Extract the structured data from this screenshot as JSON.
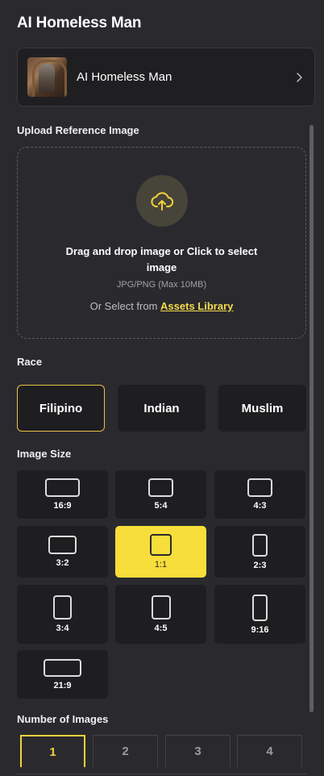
{
  "page": {
    "title": "AI Homeless Man"
  },
  "model": {
    "name": "AI Homeless Man",
    "thumbnail_icon": "model-thumbnail-image",
    "chevron_icon": "chevron-right-icon"
  },
  "upload": {
    "label": "Upload Reference Image",
    "icon": "cloud-upload-icon",
    "main_text": "Drag and drop image or Click to select image",
    "format_text": "JPG/PNG (Max 10MB)",
    "or_text": "Or Select from",
    "library_link": "Assets Library"
  },
  "race": {
    "label": "Race",
    "options": [
      "Filipino",
      "Indian",
      "Muslim"
    ],
    "selected": "Filipino"
  },
  "image_size": {
    "label": "Image Size",
    "options": [
      "16:9",
      "5:4",
      "4:3",
      "3:2",
      "1:1",
      "2:3",
      "3:4",
      "4:5",
      "9:16",
      "21:9"
    ],
    "selected": "1:1"
  },
  "num_images": {
    "label": "Number of Images",
    "options": [
      "1",
      "2",
      "3",
      "4"
    ],
    "selected": "1"
  },
  "colors": {
    "background": "#2a2a2e",
    "card": "#1e1e21",
    "accent": "#f7de3a",
    "link": "#f5dc4a"
  }
}
